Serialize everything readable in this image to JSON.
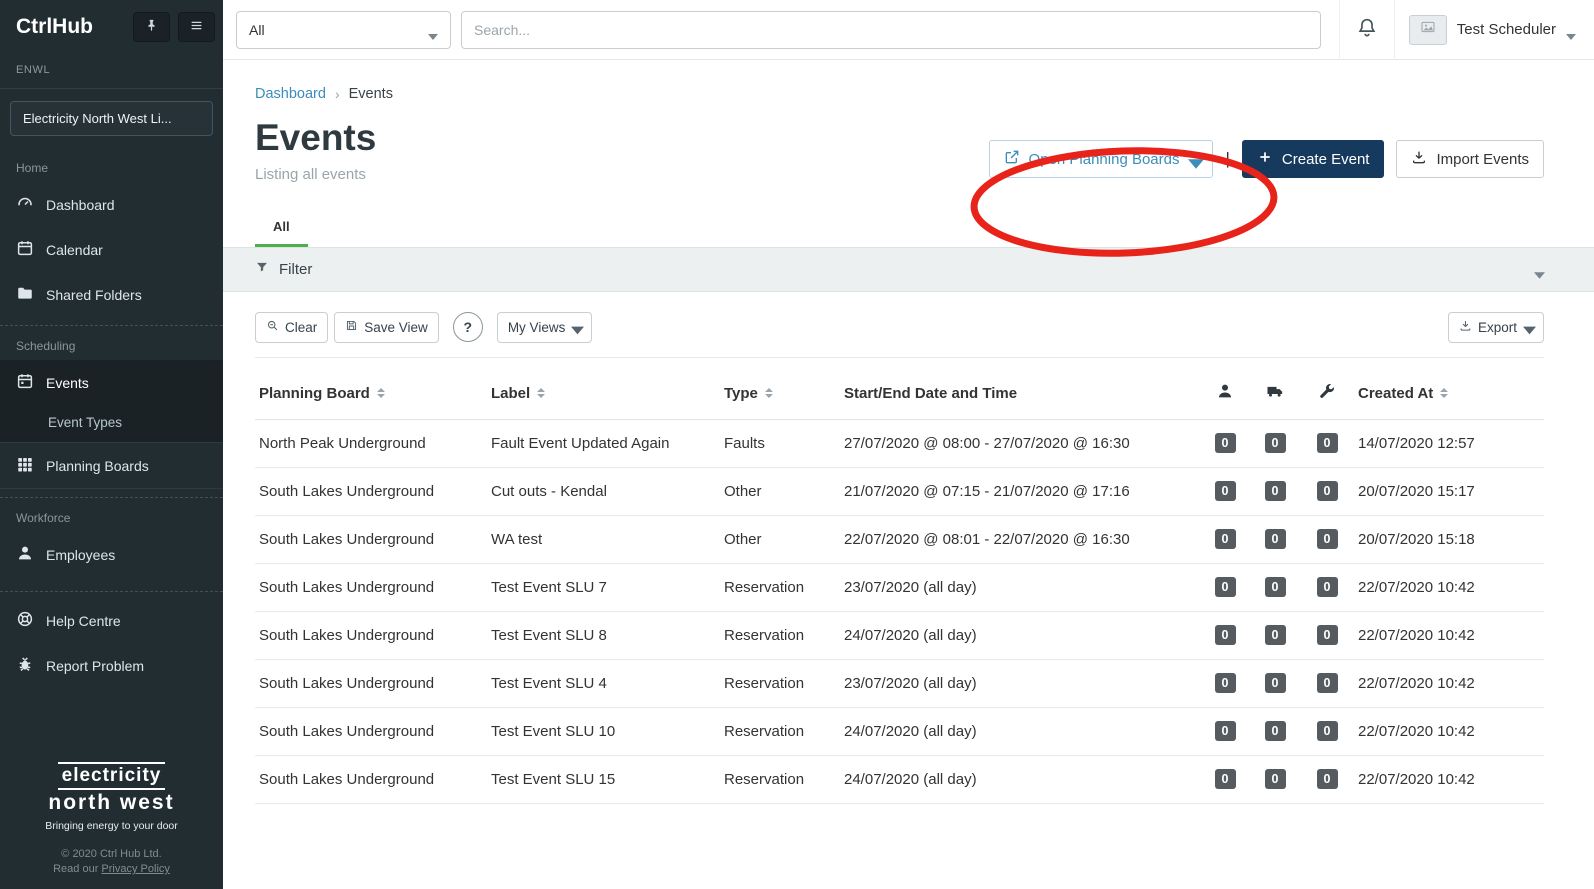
{
  "sidebar": {
    "brand": "CtrlHub",
    "org_group": "ENWL",
    "org_selector": "Electricity North West Li...",
    "sections": {
      "home_label": "Home",
      "scheduling_label": "Scheduling",
      "workforce_label": "Workforce"
    },
    "items": {
      "dashboard": "Dashboard",
      "calendar": "Calendar",
      "shared_folders": "Shared Folders",
      "events": "Events",
      "event_types": "Event Types",
      "planning_boards": "Planning Boards",
      "employees": "Employees",
      "help_centre": "Help Centre",
      "report_problem": "Report Problem"
    },
    "footer": {
      "logo_line1": "electricity",
      "logo_line2": "north west",
      "tagline": "Bringing energy to your door",
      "copyright": "© 2020 Ctrl Hub Ltd.",
      "privacy_prefix": "Read our ",
      "privacy_link": "Privacy Policy"
    }
  },
  "topbar": {
    "scope_select": "All",
    "search_placeholder": "Search...",
    "user_name": "Test Scheduler"
  },
  "breadcrumb": {
    "home": "Dashboard",
    "separator": "›",
    "current": "Events"
  },
  "page": {
    "title": "Events",
    "subtitle": "Listing all events"
  },
  "actions": {
    "open_planning_boards": "Open Planning Boards",
    "divider": "|",
    "create_event": "Create Event",
    "import_events": "Import Events"
  },
  "tabs": {
    "all": "All"
  },
  "filter": {
    "label": "Filter"
  },
  "toolbar": {
    "clear": "Clear",
    "save_view": "Save View",
    "help": "?",
    "my_views": "My Views",
    "export": "Export"
  },
  "table": {
    "headers": {
      "planning_board": "Planning Board",
      "label": "Label",
      "type": "Type",
      "datetime": "Start/End Date and Time",
      "created_at": "Created At"
    },
    "icon_columns": [
      "person-icon",
      "truck-icon",
      "wrench-icon"
    ],
    "rows": [
      {
        "planning_board": "North Peak Underground",
        "label": "Fault Event Updated Again",
        "type": "Faults",
        "datetime": "27/07/2020 @ 08:00 - 27/07/2020 @ 16:30",
        "people": "0",
        "vehicles": "0",
        "equipment": "0",
        "created_at": "14/07/2020 12:57"
      },
      {
        "planning_board": "South Lakes Underground",
        "label": "Cut outs - Kendal",
        "type": "Other",
        "datetime": "21/07/2020 @ 07:15 - 21/07/2020 @ 17:16",
        "people": "0",
        "vehicles": "0",
        "equipment": "0",
        "created_at": "20/07/2020 15:17"
      },
      {
        "planning_board": "South Lakes Underground",
        "label": "WA test",
        "type": "Other",
        "datetime": "22/07/2020 @ 08:01 - 22/07/2020 @ 16:30",
        "people": "0",
        "vehicles": "0",
        "equipment": "0",
        "created_at": "20/07/2020 15:18"
      },
      {
        "planning_board": "South Lakes Underground",
        "label": "Test Event SLU 7",
        "type": "Reservation",
        "datetime": "23/07/2020 (all day)",
        "people": "0",
        "vehicles": "0",
        "equipment": "0",
        "created_at": "22/07/2020 10:42"
      },
      {
        "planning_board": "South Lakes Underground",
        "label": "Test Event SLU 8",
        "type": "Reservation",
        "datetime": "24/07/2020 (all day)",
        "people": "0",
        "vehicles": "0",
        "equipment": "0",
        "created_at": "22/07/2020 10:42"
      },
      {
        "planning_board": "South Lakes Underground",
        "label": "Test Event SLU 4",
        "type": "Reservation",
        "datetime": "23/07/2020 (all day)",
        "people": "0",
        "vehicles": "0",
        "equipment": "0",
        "created_at": "22/07/2020 10:42"
      },
      {
        "planning_board": "South Lakes Underground",
        "label": "Test Event SLU 10",
        "type": "Reservation",
        "datetime": "24/07/2020 (all day)",
        "people": "0",
        "vehicles": "0",
        "equipment": "0",
        "created_at": "22/07/2020 10:42"
      },
      {
        "planning_board": "South Lakes Underground",
        "label": "Test Event SLU 15",
        "type": "Reservation",
        "datetime": "24/07/2020 (all day)",
        "people": "0",
        "vehicles": "0",
        "equipment": "0",
        "created_at": "22/07/2020 10:42"
      }
    ]
  },
  "icons": {
    "pin": "pushpin",
    "hamburger": "≡",
    "dashboard": "gauge",
    "calendar": "calendar",
    "shared_folders": "folder",
    "planning_boards": "grid",
    "employees": "person",
    "help": "life-ring",
    "report_problem": "bug",
    "bell": "bell-outline",
    "avatar": "image-placeholder",
    "caret_down": "▾",
    "filter": "funnel",
    "clear": "magnifier",
    "save_view": "floppy-disk",
    "external_link": "box-arrow",
    "plus": "+",
    "download": "arrow-into-tray",
    "sort": "▲▼",
    "col_person": "person",
    "col_vehicle": "truck",
    "col_equipment": "wrench"
  },
  "colors": {
    "sidebar_bg": "#222d32",
    "sidebar_active_bg": "#1a2226",
    "link_blue": "#3c8dbc",
    "navy_button": "#16395e",
    "tab_green": "#4caf50",
    "badge_gray": "#565b60",
    "annotation_red": "#e8231a"
  }
}
